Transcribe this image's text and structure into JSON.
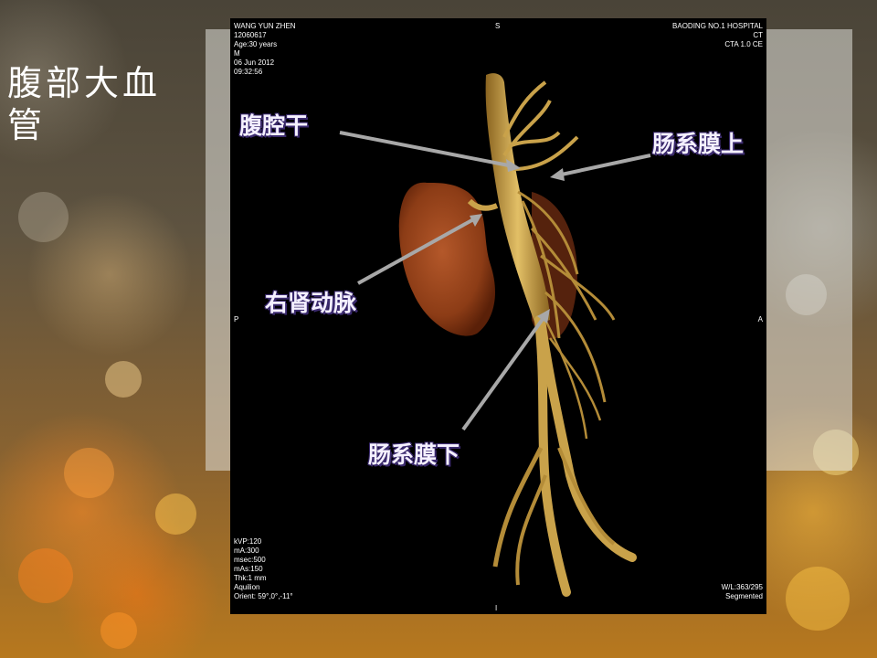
{
  "slide": {
    "title": "腹部大血管"
  },
  "ct": {
    "patient": {
      "name": "WANG YUN ZHEN",
      "id": "12060617",
      "age": "Age:30 years",
      "sex": "M",
      "date": "06 Jun 2012",
      "time": "09:32:56"
    },
    "institution": {
      "hospital": "BAODING NO.1 HOSPITAL",
      "modality": "CT",
      "series": "CTA 1.0 CE"
    },
    "orientation": {
      "top": "S",
      "bottom": "I",
      "left": "P",
      "right": "A"
    },
    "params": {
      "kvp": "kVP:120",
      "ma": "mA:300",
      "msec": "msec:500",
      "mas": "mAs:150",
      "thk": "Thk:1 mm",
      "scanner": "Aquilion",
      "orient": "Orient: 59°,0°,-11°"
    },
    "window": {
      "wl": "W/L:363/295",
      "mode": "Segmented"
    }
  },
  "labels": {
    "celiac": "腹腔干",
    "sma": "肠系膜上",
    "renal": "右肾动脉",
    "ima": "肠系膜下"
  },
  "colors": {
    "label_text": "#f4f0ff",
    "label_outline": "#3b2a6e",
    "arrow": "#a8a8a8",
    "vessel": "#c9a24a",
    "kidney": "#9a4418"
  }
}
